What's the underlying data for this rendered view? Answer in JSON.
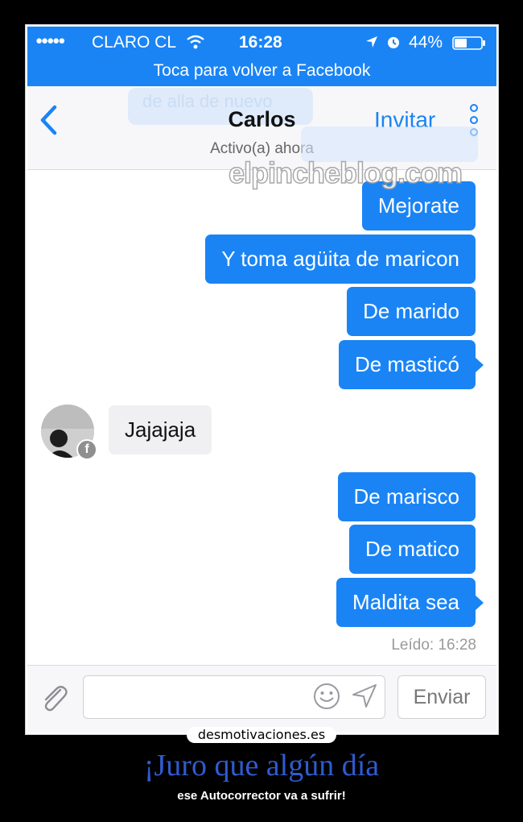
{
  "status_bar": {
    "signal_dots": "●●●●●",
    "carrier": "CLARO CL",
    "time": "16:28",
    "battery": "44%",
    "icons": [
      "wifi-icon",
      "location-icon",
      "alarm-icon",
      "battery-icon"
    ]
  },
  "return_bar": {
    "label": "Toca para volver a Facebook"
  },
  "header": {
    "contact_name": "Carlos",
    "presence": "Activo(a) ahora",
    "invite_label": "Invitar",
    "ghost_text": "de alla de nuevo"
  },
  "watermark": "elpincheblog.com",
  "messages": [
    {
      "text": "Mejorate",
      "direction": "outgoing"
    },
    {
      "text": "Y toma agüita de maricon",
      "direction": "outgoing"
    },
    {
      "text": "De marido",
      "direction": "outgoing"
    },
    {
      "text": "De masticó",
      "direction": "outgoing"
    },
    {
      "text": "Jajajaja",
      "direction": "incoming"
    },
    {
      "text": "De marisco",
      "direction": "outgoing"
    },
    {
      "text": "De matico",
      "direction": "outgoing"
    },
    {
      "text": "Maldita sea",
      "direction": "outgoing"
    }
  ],
  "read_receipt": "Leído: 16:28",
  "composer": {
    "placeholder": "",
    "send_label": "Enviar"
  },
  "poster": {
    "site": "desmotivaciones.es",
    "title": "¡Juro que algún día",
    "subtitle": "ese Autocorrector va a sufrir!"
  },
  "colors": {
    "accent": "#1a84f5",
    "incoming_bubble": "#f0f0f2",
    "title": "#2f5bd0"
  }
}
